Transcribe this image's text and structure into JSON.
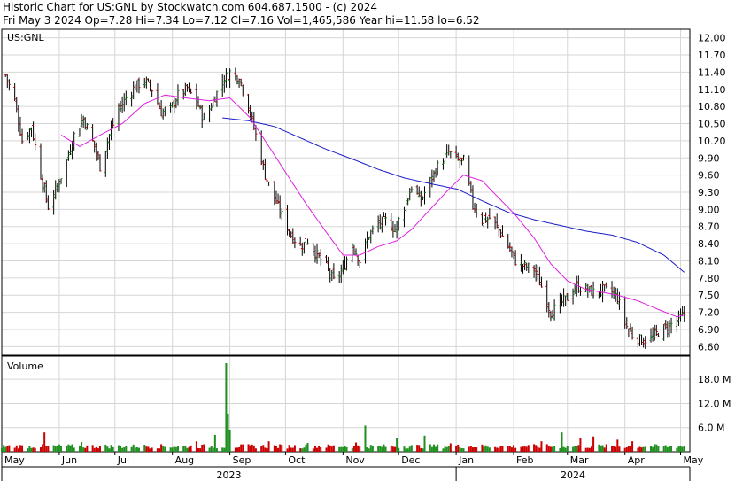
{
  "header": {
    "line1": "Historic Chart for US:GNL by Stockwatch.com 604.687.1500 - (c) 2024",
    "line2": "Fri May  3 2024  Op=7.28  Hi=7.34  Lo=7.12  Cl=7.16  Vol=1,465,586  Year hi=11.58  lo=6.52"
  },
  "colors": {
    "up_bar": "#1f8f1f",
    "down_bar": "#cc0000",
    "price_bar": "#000000",
    "ma_short": "#e020e0",
    "ma_long": "#1c1cc8",
    "grid": "#d6d6d6"
  },
  "chart_data": [
    {
      "type": "ohlc",
      "symbol_label": "US:GNL",
      "ylim": [
        6.45,
        12.15
      ],
      "yticks": [
        "12.00",
        "11.70",
        "11.40",
        "11.10",
        "10.80",
        "10.50",
        "10.20",
        "9.90",
        "9.60",
        "9.30",
        "9.00",
        "8.70",
        "8.40",
        "8.10",
        "7.80",
        "7.50",
        "7.20",
        "6.90",
        "6.60"
      ],
      "grid": true,
      "close_anchors": [
        [
          "2023-05-03",
          11.35
        ],
        [
          "2023-05-08",
          10.9
        ],
        [
          "2023-05-12",
          10.2
        ],
        [
          "2023-05-17",
          10.45
        ],
        [
          "2023-05-22",
          9.6
        ],
        [
          "2023-05-26",
          9.05
        ],
        [
          "2023-05-31",
          9.4
        ],
        [
          "2023-06-05",
          9.85
        ],
        [
          "2023-06-09",
          10.3
        ],
        [
          "2023-06-14",
          10.6
        ],
        [
          "2023-06-20",
          10.1
        ],
        [
          "2023-06-23",
          9.75
        ],
        [
          "2023-06-28",
          10.3
        ],
        [
          "2023-07-03",
          10.75
        ],
        [
          "2023-07-07",
          10.95
        ],
        [
          "2023-07-12",
          11.15
        ],
        [
          "2023-07-17",
          11.25
        ],
        [
          "2023-07-21",
          11.1
        ],
        [
          "2023-07-26",
          10.7
        ],
        [
          "2023-07-31",
          10.75
        ],
        [
          "2023-08-04",
          11.0
        ],
        [
          "2023-08-09",
          11.1
        ],
        [
          "2023-08-14",
          10.9
        ],
        [
          "2023-08-18",
          10.55
        ],
        [
          "2023-08-23",
          10.9
        ],
        [
          "2023-08-28",
          11.25
        ],
        [
          "2023-09-01",
          11.4
        ],
        [
          "2023-09-06",
          11.3
        ],
        [
          "2023-09-11",
          10.8
        ],
        [
          "2023-09-15",
          10.3
        ],
        [
          "2023-09-20",
          9.6
        ],
        [
          "2023-09-25",
          9.2
        ],
        [
          "2023-09-29",
          8.9
        ],
        [
          "2023-10-04",
          8.55
        ],
        [
          "2023-10-09",
          8.35
        ],
        [
          "2023-10-13",
          8.45
        ],
        [
          "2023-10-18",
          8.2
        ],
        [
          "2023-10-23",
          8.0
        ],
        [
          "2023-10-27",
          7.75
        ],
        [
          "2023-11-01",
          7.95
        ],
        [
          "2023-11-06",
          8.4
        ],
        [
          "2023-11-10",
          8.1
        ],
        [
          "2023-11-15",
          8.55
        ],
        [
          "2023-11-20",
          8.75
        ],
        [
          "2023-11-24",
          8.8
        ],
        [
          "2023-11-29",
          8.65
        ],
        [
          "2023-12-04",
          9.05
        ],
        [
          "2023-12-08",
          9.4
        ],
        [
          "2023-12-13",
          9.15
        ],
        [
          "2023-12-18",
          9.5
        ],
        [
          "2023-12-22",
          9.75
        ],
        [
          "2023-12-28",
          10.0
        ],
        [
          "2024-01-02",
          9.85
        ],
        [
          "2024-01-05",
          9.85
        ],
        [
          "2024-01-10",
          9.1
        ],
        [
          "2024-01-15",
          8.8
        ],
        [
          "2024-01-19",
          8.85
        ],
        [
          "2024-01-24",
          8.65
        ],
        [
          "2024-01-29",
          8.35
        ],
        [
          "2024-02-02",
          8.1
        ],
        [
          "2024-02-07",
          8.0
        ],
        [
          "2024-02-12",
          7.95
        ],
        [
          "2024-02-16",
          7.65
        ],
        [
          "2024-02-21",
          7.2
        ],
        [
          "2024-02-26",
          7.35
        ],
        [
          "2024-03-01",
          7.45
        ],
        [
          "2024-03-06",
          7.65
        ],
        [
          "2024-03-11",
          7.6
        ],
        [
          "2024-03-15",
          7.55
        ],
        [
          "2024-03-20",
          7.6
        ],
        [
          "2024-03-25",
          7.55
        ],
        [
          "2024-03-28",
          7.45
        ],
        [
          "2024-04-02",
          6.95
        ],
        [
          "2024-04-05",
          6.8
        ],
        [
          "2024-04-10",
          6.7
        ],
        [
          "2024-04-15",
          6.75
        ],
        [
          "2024-04-19",
          6.85
        ],
        [
          "2024-04-24",
          6.95
        ],
        [
          "2024-04-29",
          7.05
        ],
        [
          "2024-05-03",
          7.16
        ]
      ],
      "ma_short_anchors": [
        [
          "2023-06-02",
          10.3
        ],
        [
          "2023-06-12",
          10.1
        ],
        [
          "2023-06-23",
          10.3
        ],
        [
          "2023-07-05",
          10.5
        ],
        [
          "2023-07-17",
          10.85
        ],
        [
          "2023-07-28",
          11.0
        ],
        [
          "2023-08-08",
          10.95
        ],
        [
          "2023-08-21",
          10.9
        ],
        [
          "2023-09-01",
          10.95
        ],
        [
          "2023-09-12",
          10.6
        ],
        [
          "2023-09-22",
          10.1
        ],
        [
          "2023-10-02",
          9.6
        ],
        [
          "2023-10-12",
          9.1
        ],
        [
          "2023-10-23",
          8.6
        ],
        [
          "2023-11-01",
          8.2
        ],
        [
          "2023-11-10",
          8.2
        ],
        [
          "2023-11-20",
          8.35
        ],
        [
          "2023-11-30",
          8.45
        ],
        [
          "2023-12-08",
          8.65
        ],
        [
          "2023-12-18",
          9.0
        ],
        [
          "2023-12-28",
          9.35
        ],
        [
          "2024-01-05",
          9.6
        ],
        [
          "2024-01-15",
          9.5
        ],
        [
          "2024-01-24",
          9.2
        ],
        [
          "2024-02-02",
          8.9
        ],
        [
          "2024-02-12",
          8.5
        ],
        [
          "2024-02-21",
          8.05
        ],
        [
          "2024-03-01",
          7.75
        ],
        [
          "2024-03-11",
          7.6
        ],
        [
          "2024-03-20",
          7.55
        ],
        [
          "2024-03-28",
          7.5
        ],
        [
          "2024-04-08",
          7.4
        ],
        [
          "2024-04-19",
          7.25
        ],
        [
          "2024-04-29",
          7.12
        ],
        [
          "2024-05-03",
          7.15
        ]
      ],
      "ma_long_anchors": [
        [
          "2023-08-28",
          10.6
        ],
        [
          "2023-09-11",
          10.55
        ],
        [
          "2023-09-25",
          10.45
        ],
        [
          "2023-10-09",
          10.25
        ],
        [
          "2023-10-23",
          10.05
        ],
        [
          "2023-11-06",
          9.88
        ],
        [
          "2023-11-20",
          9.7
        ],
        [
          "2023-12-04",
          9.55
        ],
        [
          "2023-12-18",
          9.45
        ],
        [
          "2024-01-02",
          9.35
        ],
        [
          "2024-01-15",
          9.15
        ],
        [
          "2024-01-29",
          8.95
        ],
        [
          "2024-02-12",
          8.82
        ],
        [
          "2024-02-26",
          8.72
        ],
        [
          "2024-03-11",
          8.62
        ],
        [
          "2024-03-25",
          8.55
        ],
        [
          "2024-04-08",
          8.42
        ],
        [
          "2024-04-22",
          8.2
        ],
        [
          "2024-05-03",
          7.9
        ]
      ]
    },
    {
      "type": "bar",
      "title": "Volume",
      "ylim": [
        0,
        22
      ],
      "yticks": [
        "18.0 M",
        "12.0 M",
        "6.0 M"
      ],
      "spikes": [
        [
          "2023-05-24",
          4.8
        ],
        [
          "2023-06-13",
          2.4
        ],
        [
          "2023-08-14",
          2.6
        ],
        [
          "2023-08-24",
          4.2
        ],
        [
          "2023-08-30",
          22.0
        ],
        [
          "2023-08-31",
          9.5
        ],
        [
          "2023-09-01",
          5.5
        ],
        [
          "2023-09-22",
          2.6
        ],
        [
          "2023-10-13",
          2.2
        ],
        [
          "2023-11-08",
          2.3
        ],
        [
          "2023-11-13",
          6.5
        ],
        [
          "2023-11-30",
          3.5
        ],
        [
          "2023-12-15",
          4.0
        ],
        [
          "2023-12-29",
          2.1
        ],
        [
          "2024-02-16",
          2.6
        ],
        [
          "2024-02-27",
          4.8
        ],
        [
          "2024-03-08",
          3.5
        ],
        [
          "2024-03-15",
          3.8
        ],
        [
          "2024-03-28",
          3.0
        ],
        [
          "2024-04-05",
          2.6
        ]
      ]
    }
  ],
  "x_axis": {
    "months": [
      {
        "label": "May",
        "date": "2023-05-01"
      },
      {
        "label": "Jun",
        "date": "2023-06-01"
      },
      {
        "label": "Jul",
        "date": "2023-07-01"
      },
      {
        "label": "Aug",
        "date": "2023-08-01"
      },
      {
        "label": "Sep",
        "date": "2023-09-01"
      },
      {
        "label": "Oct",
        "date": "2023-10-01"
      },
      {
        "label": "Nov",
        "date": "2023-11-01"
      },
      {
        "label": "Dec",
        "date": "2023-12-01"
      },
      {
        "label": "Jan",
        "date": "2024-01-01"
      },
      {
        "label": "Feb",
        "date": "2024-02-01"
      },
      {
        "label": "Mar",
        "date": "2024-03-01"
      },
      {
        "label": "Apr",
        "date": "2024-04-01"
      },
      {
        "label": "May",
        "date": "2024-05-01"
      }
    ],
    "years": [
      {
        "label": "2023",
        "from": "2023-05-01",
        "to": "2024-01-01"
      },
      {
        "label": "2024",
        "from": "2024-01-01",
        "to": "2024-05-06"
      }
    ]
  }
}
